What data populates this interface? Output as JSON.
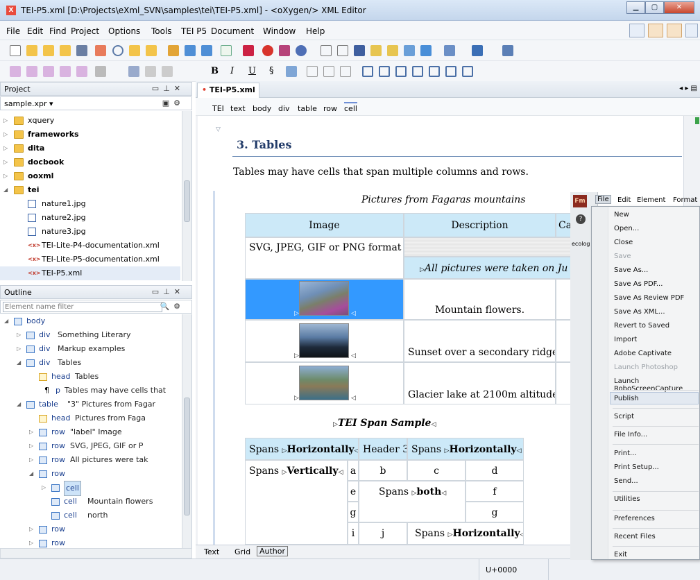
{
  "window": {
    "title": "TEI-P5.xml [D:\\Projects\\eXml_SVN\\samples\\tei\\TEI-P5.xml] - <oXygen/> XML Editor"
  },
  "menu": [
    "File",
    "Edit",
    "Find",
    "Project",
    "Options",
    "Tools",
    "TEI P5",
    "Document",
    "Window",
    "Help"
  ],
  "project": {
    "title": "Project",
    "file": "sample.xpr ▾",
    "items": [
      {
        "label": "xquery",
        "type": "folder",
        "bold": false
      },
      {
        "label": "frameworks",
        "type": "folder",
        "bold": true
      },
      {
        "label": "dita",
        "type": "folder",
        "bold": true
      },
      {
        "label": "docbook",
        "type": "folder",
        "bold": true
      },
      {
        "label": "ooxml",
        "type": "folder",
        "bold": true
      },
      {
        "label": "tei",
        "type": "folder",
        "bold": true
      },
      {
        "label": "nature1.jpg",
        "type": "img"
      },
      {
        "label": "nature2.jpg",
        "type": "img"
      },
      {
        "label": "nature3.jpg",
        "type": "img"
      },
      {
        "label": "TEI-Lite-P4-documentation.xml",
        "type": "xml"
      },
      {
        "label": "TEI-Lite-P5-documentation.xml",
        "type": "xml"
      },
      {
        "label": "TEI-P5.xml",
        "type": "xml"
      }
    ]
  },
  "outline": {
    "title": "Outline",
    "filter_placeholder": "Element name filter",
    "items": [
      {
        "tag": "body",
        "text": ""
      },
      {
        "tag": "div",
        "text": "Something Literary"
      },
      {
        "tag": "div",
        "text": "Markup examples"
      },
      {
        "tag": "div",
        "text": "Tables"
      },
      {
        "tag": "head",
        "text": "Tables"
      },
      {
        "tag": "p",
        "text": "Tables may have cells that"
      },
      {
        "tag": "table",
        "text": "\"3\" Pictures from Fagar"
      },
      {
        "tag": "head",
        "text": "Pictures from Faga"
      },
      {
        "tag": "row",
        "text": "\"label\" Image"
      },
      {
        "tag": "row",
        "text": "SVG, JPEG, GIF or P"
      },
      {
        "tag": "row",
        "text": "All pictures were tak"
      },
      {
        "tag": "row",
        "text": ""
      },
      {
        "tag": "cell",
        "text": ""
      },
      {
        "tag": "cell",
        "text": "Mountain flowers"
      },
      {
        "tag": "cell",
        "text": "north"
      },
      {
        "tag": "row",
        "text": ""
      },
      {
        "tag": "row",
        "text": ""
      }
    ]
  },
  "editor": {
    "tab": "TEI-P5.xml",
    "breadcrumb": [
      "TEI",
      "text",
      "body",
      "div",
      "table",
      "row",
      "cell"
    ],
    "heading": "3. Tables",
    "paragraph": "Tables may have cells that span multiple columns and rows.",
    "caption": "Pictures from Fagaras mountains",
    "table1": {
      "headers": [
        "Image",
        "Description",
        "Ca"
      ],
      "formats": "SVG, JPEG, GIF or PNG format",
      "note": "All pictures were taken on Ju",
      "descriptions": [
        "Mountain flowers.",
        "Sunset over a secondary ridge.",
        "Glacier lake at 2100m altitude."
      ]
    },
    "span_title": "TEI Span Sample",
    "table2": {
      "spans_prefix": "Spans ",
      "horizontally": "Horizontally",
      "vertically": "Vertically",
      "both": "both",
      "header3": "Header 3",
      "letters": [
        "a",
        "b",
        "c",
        "d",
        "e",
        "f",
        "g",
        "g",
        "i",
        "j"
      ]
    },
    "modes": [
      "Text",
      "Grid",
      "Author"
    ]
  },
  "status": {
    "unicode": "U+0000"
  },
  "framemaker": {
    "menubar": [
      "File",
      "Edit",
      "Element",
      "Format"
    ],
    "side_label": "ecolog",
    "items": [
      {
        "label": "New",
        "disabled": false
      },
      {
        "label": "Open...",
        "disabled": false
      },
      {
        "label": "Close",
        "disabled": false
      },
      {
        "label": "Save",
        "disabled": true
      },
      {
        "label": "Save As...",
        "disabled": false
      },
      {
        "label": "Save As PDF...",
        "disabled": false
      },
      {
        "label": "Save As Review PDF",
        "disabled": false
      },
      {
        "label": "Save As XML...",
        "disabled": false
      },
      {
        "label": "Revert to Saved",
        "disabled": false
      },
      {
        "label": "Import",
        "disabled": false
      },
      {
        "label": "Adobe Captivate",
        "disabled": false
      },
      {
        "label": "Launch Photoshop",
        "disabled": true
      },
      {
        "label": "Launch RoboScreenCapture",
        "disabled": false
      },
      {
        "label": "Publish",
        "disabled": false
      },
      {
        "label": "Script",
        "disabled": false
      },
      {
        "label": "File Info...",
        "disabled": false
      },
      {
        "label": "Print...",
        "disabled": false
      },
      {
        "label": "Print Setup...",
        "disabled": false
      },
      {
        "label": "Send...",
        "disabled": false
      },
      {
        "label": "Utilities",
        "disabled": false
      },
      {
        "label": "Preferences",
        "disabled": false
      },
      {
        "label": "Recent Files",
        "disabled": false
      },
      {
        "label": "Exit",
        "disabled": false
      }
    ]
  },
  "colors": {
    "accent": "#3399ff",
    "header_cell": "#cce9f8",
    "heading": "#203a68"
  }
}
